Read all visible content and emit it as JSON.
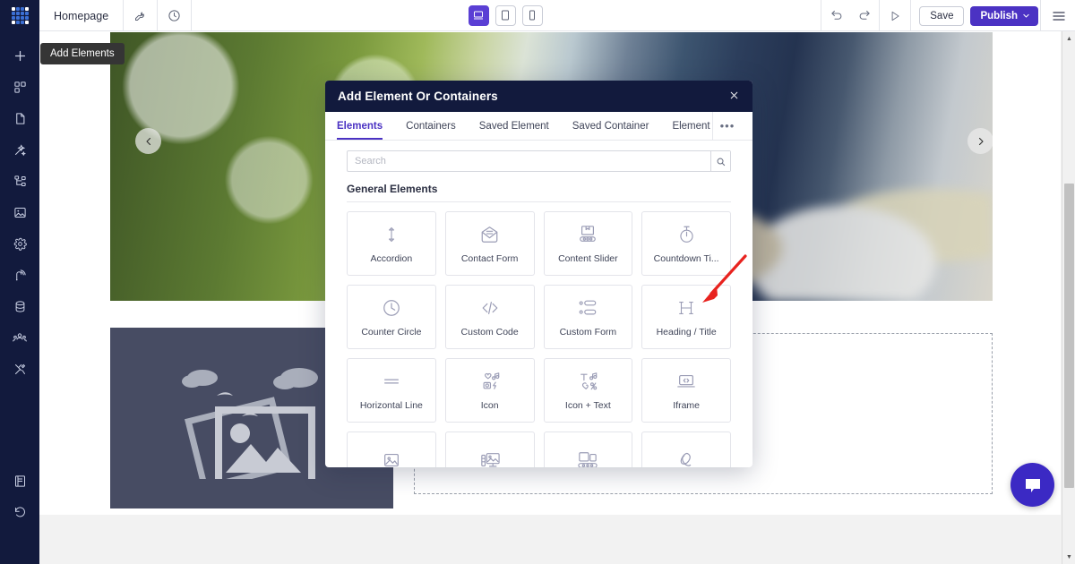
{
  "topbar": {
    "logo_icon": "grid-logo-icon",
    "page_name": "Homepage",
    "tool_icon": "wrench-icon",
    "history_icon": "clock-icon",
    "devices": [
      {
        "name": "desktop",
        "icon": "desktop-icon",
        "active": true
      },
      {
        "name": "tablet",
        "icon": "tablet-icon",
        "active": false
      },
      {
        "name": "mobile",
        "icon": "mobile-icon",
        "active": false
      }
    ],
    "undo_icon": "undo-icon",
    "redo_icon": "redo-icon",
    "preview_icon": "play-preview-icon",
    "save_label": "Save",
    "publish_label": "Publish",
    "publish_chevron": "chevron-down-icon",
    "menu_icon": "hamburger-menu-icon",
    "accent_color": "#4b32c3",
    "bar_bg": "#ffffff",
    "logo_bg": "#121a3d"
  },
  "tooltip": {
    "text": "Add Elements",
    "bg": "#353535"
  },
  "sidebar": {
    "bg": "#121a3d",
    "items": [
      {
        "name": "add-elements",
        "icon": "plus-icon"
      },
      {
        "name": "blocks",
        "icon": "blocks-grid-icon"
      },
      {
        "name": "pages",
        "icon": "page-icon"
      },
      {
        "name": "design",
        "icon": "magic-wand-icon"
      },
      {
        "name": "structure",
        "icon": "sitemap-icon"
      },
      {
        "name": "media",
        "icon": "image-icon"
      },
      {
        "name": "settings",
        "icon": "gear-icon"
      },
      {
        "name": "publish-status",
        "icon": "broadcast-icon"
      },
      {
        "name": "data",
        "icon": "database-icon"
      },
      {
        "name": "users",
        "icon": "users-icon"
      },
      {
        "name": "tools",
        "icon": "tools-icon"
      }
    ],
    "bottom_items": [
      {
        "name": "docs",
        "icon": "book-icon"
      },
      {
        "name": "revisions",
        "icon": "history-revert-icon"
      }
    ]
  },
  "canvas": {
    "hero": {
      "name": "hero-slider",
      "prev_icon": "chevron-left-icon",
      "next_icon": "chevron-right-icon",
      "description": "gardener with gloves holding watering can, blurred green foliage"
    },
    "image_placeholder": {
      "name": "image-placeholder",
      "icon": "image-placeholder-icon",
      "bg": "#474c63"
    },
    "dropzone": {
      "name": "empty-drop-zone",
      "border": "#9aa0ab"
    },
    "chat_fab": {
      "name": "chat-widget-button",
      "icon": "chat-bubble-icon",
      "color": "#3b29c4"
    },
    "scrollbar": {
      "up_icon": "scroll-up-arrow-icon",
      "down_icon": "scroll-down-arrow-icon"
    }
  },
  "modal": {
    "title": "Add Element Or Containers",
    "close_icon": "close-icon",
    "header_bg": "#121a3d",
    "tabs": [
      {
        "label": "Elements",
        "active": true
      },
      {
        "label": "Containers",
        "active": false
      },
      {
        "label": "Saved Element",
        "active": false
      },
      {
        "label": "Saved Container",
        "active": false
      },
      {
        "label": "Element S",
        "active": false
      }
    ],
    "tabs_more_label": "•••",
    "search": {
      "value": "",
      "placeholder": "Search",
      "icon": "search-icon"
    },
    "section_title": "General Elements",
    "elements": [
      {
        "label": "Accordion",
        "icon": "accordion-arrows-icon"
      },
      {
        "label": "Contact Form",
        "icon": "envelope-icon"
      },
      {
        "label": "Content Slider",
        "icon": "content-slider-icon"
      },
      {
        "label": "Countdown Ti...",
        "icon": "stopwatch-icon"
      },
      {
        "label": "Counter Circle",
        "icon": "clock-circle-icon"
      },
      {
        "label": "Custom Code",
        "icon": "code-brackets-icon"
      },
      {
        "label": "Custom Form",
        "icon": "form-rows-icon"
      },
      {
        "label": "Heading / Title",
        "icon": "heading-h-icon"
      },
      {
        "label": "Horizontal Line",
        "icon": "horizontal-line-icon"
      },
      {
        "label": "Icon",
        "icon": "icon-set-icon"
      },
      {
        "label": "Icon + Text",
        "icon": "icon-text-icon"
      },
      {
        "label": "Iframe",
        "icon": "iframe-laptop-icon"
      },
      {
        "label": "",
        "icon": "image-icon"
      },
      {
        "label": "",
        "icon": "image-compare-icon"
      },
      {
        "label": "",
        "icon": "image-slider-icon"
      },
      {
        "label": "",
        "icon": "link-chain-icon"
      }
    ]
  },
  "annotation": {
    "name": "red-pointer-arrow",
    "color": "#e8231f",
    "points_to": "Heading / Title"
  }
}
